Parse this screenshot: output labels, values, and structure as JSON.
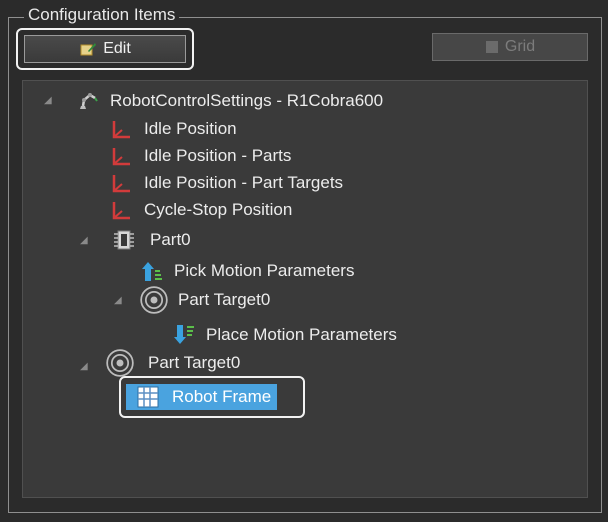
{
  "group_title": "Configuration Items",
  "toolbar": {
    "edit_label": "Edit",
    "grid_label": "Grid"
  },
  "tree": {
    "root_label": "RobotControlSettings - R1Cobra600",
    "idle_position": "Idle Position",
    "idle_position_parts": "Idle Position - Parts",
    "idle_position_part_targets": "Idle Position - Part Targets",
    "cycle_stop_position": "Cycle-Stop Position",
    "part0": "Part0",
    "pick_motion_parameters": "Pick Motion Parameters",
    "part_target_child": "Part Target0",
    "place_motion_parameters": "Place Motion Parameters",
    "part_target0": "Part Target0",
    "robot_frame": "Robot Frame"
  },
  "colors": {
    "background": "#2b2b2b",
    "tree_background": "#3a3a3a",
    "selection": "#4aa3df",
    "position_icon": "#d23b3b"
  }
}
